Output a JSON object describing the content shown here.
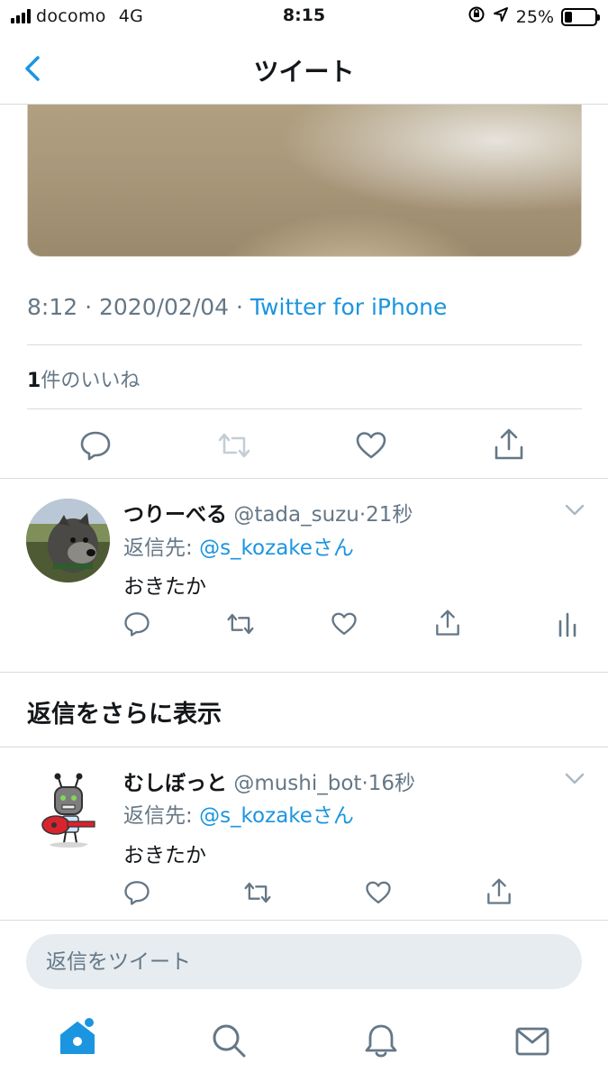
{
  "status_bar": {
    "carrier": "docomo",
    "network": "4G",
    "time": "8:15",
    "battery_percent_label": "25%",
    "battery_level": 0.25
  },
  "nav": {
    "title": "ツイート",
    "back_icon": "chevron-left-icon"
  },
  "tweet": {
    "time": "8:12",
    "date": "2020/02/04",
    "source": "Twitter for iPhone",
    "separator": " · ",
    "like_count": "1",
    "like_label": "件のいいね"
  },
  "replies": [
    {
      "display_name": "つりーべる",
      "handle": "@tada_suzu",
      "age": "21秒",
      "reply_to_label": "返信先: ",
      "reply_to_user": "@s_kozakeさん",
      "text": "おきたか"
    },
    {
      "display_name": "むしぼっと",
      "handle": "@mushi_bot",
      "age": "16秒",
      "reply_to_label": "返信先: ",
      "reply_to_user": "@s_kozakeさん",
      "text": "おきたか"
    }
  ],
  "more_replies_label": "返信をさらに表示",
  "compose": {
    "placeholder": "返信をツイート"
  },
  "tabbar": {
    "icons": [
      "home-icon",
      "search-icon",
      "notifications-icon",
      "messages-icon"
    ]
  },
  "colors": {
    "accent": "#1b95e0",
    "muted": "#657786",
    "divider": "#d6dbdf"
  }
}
